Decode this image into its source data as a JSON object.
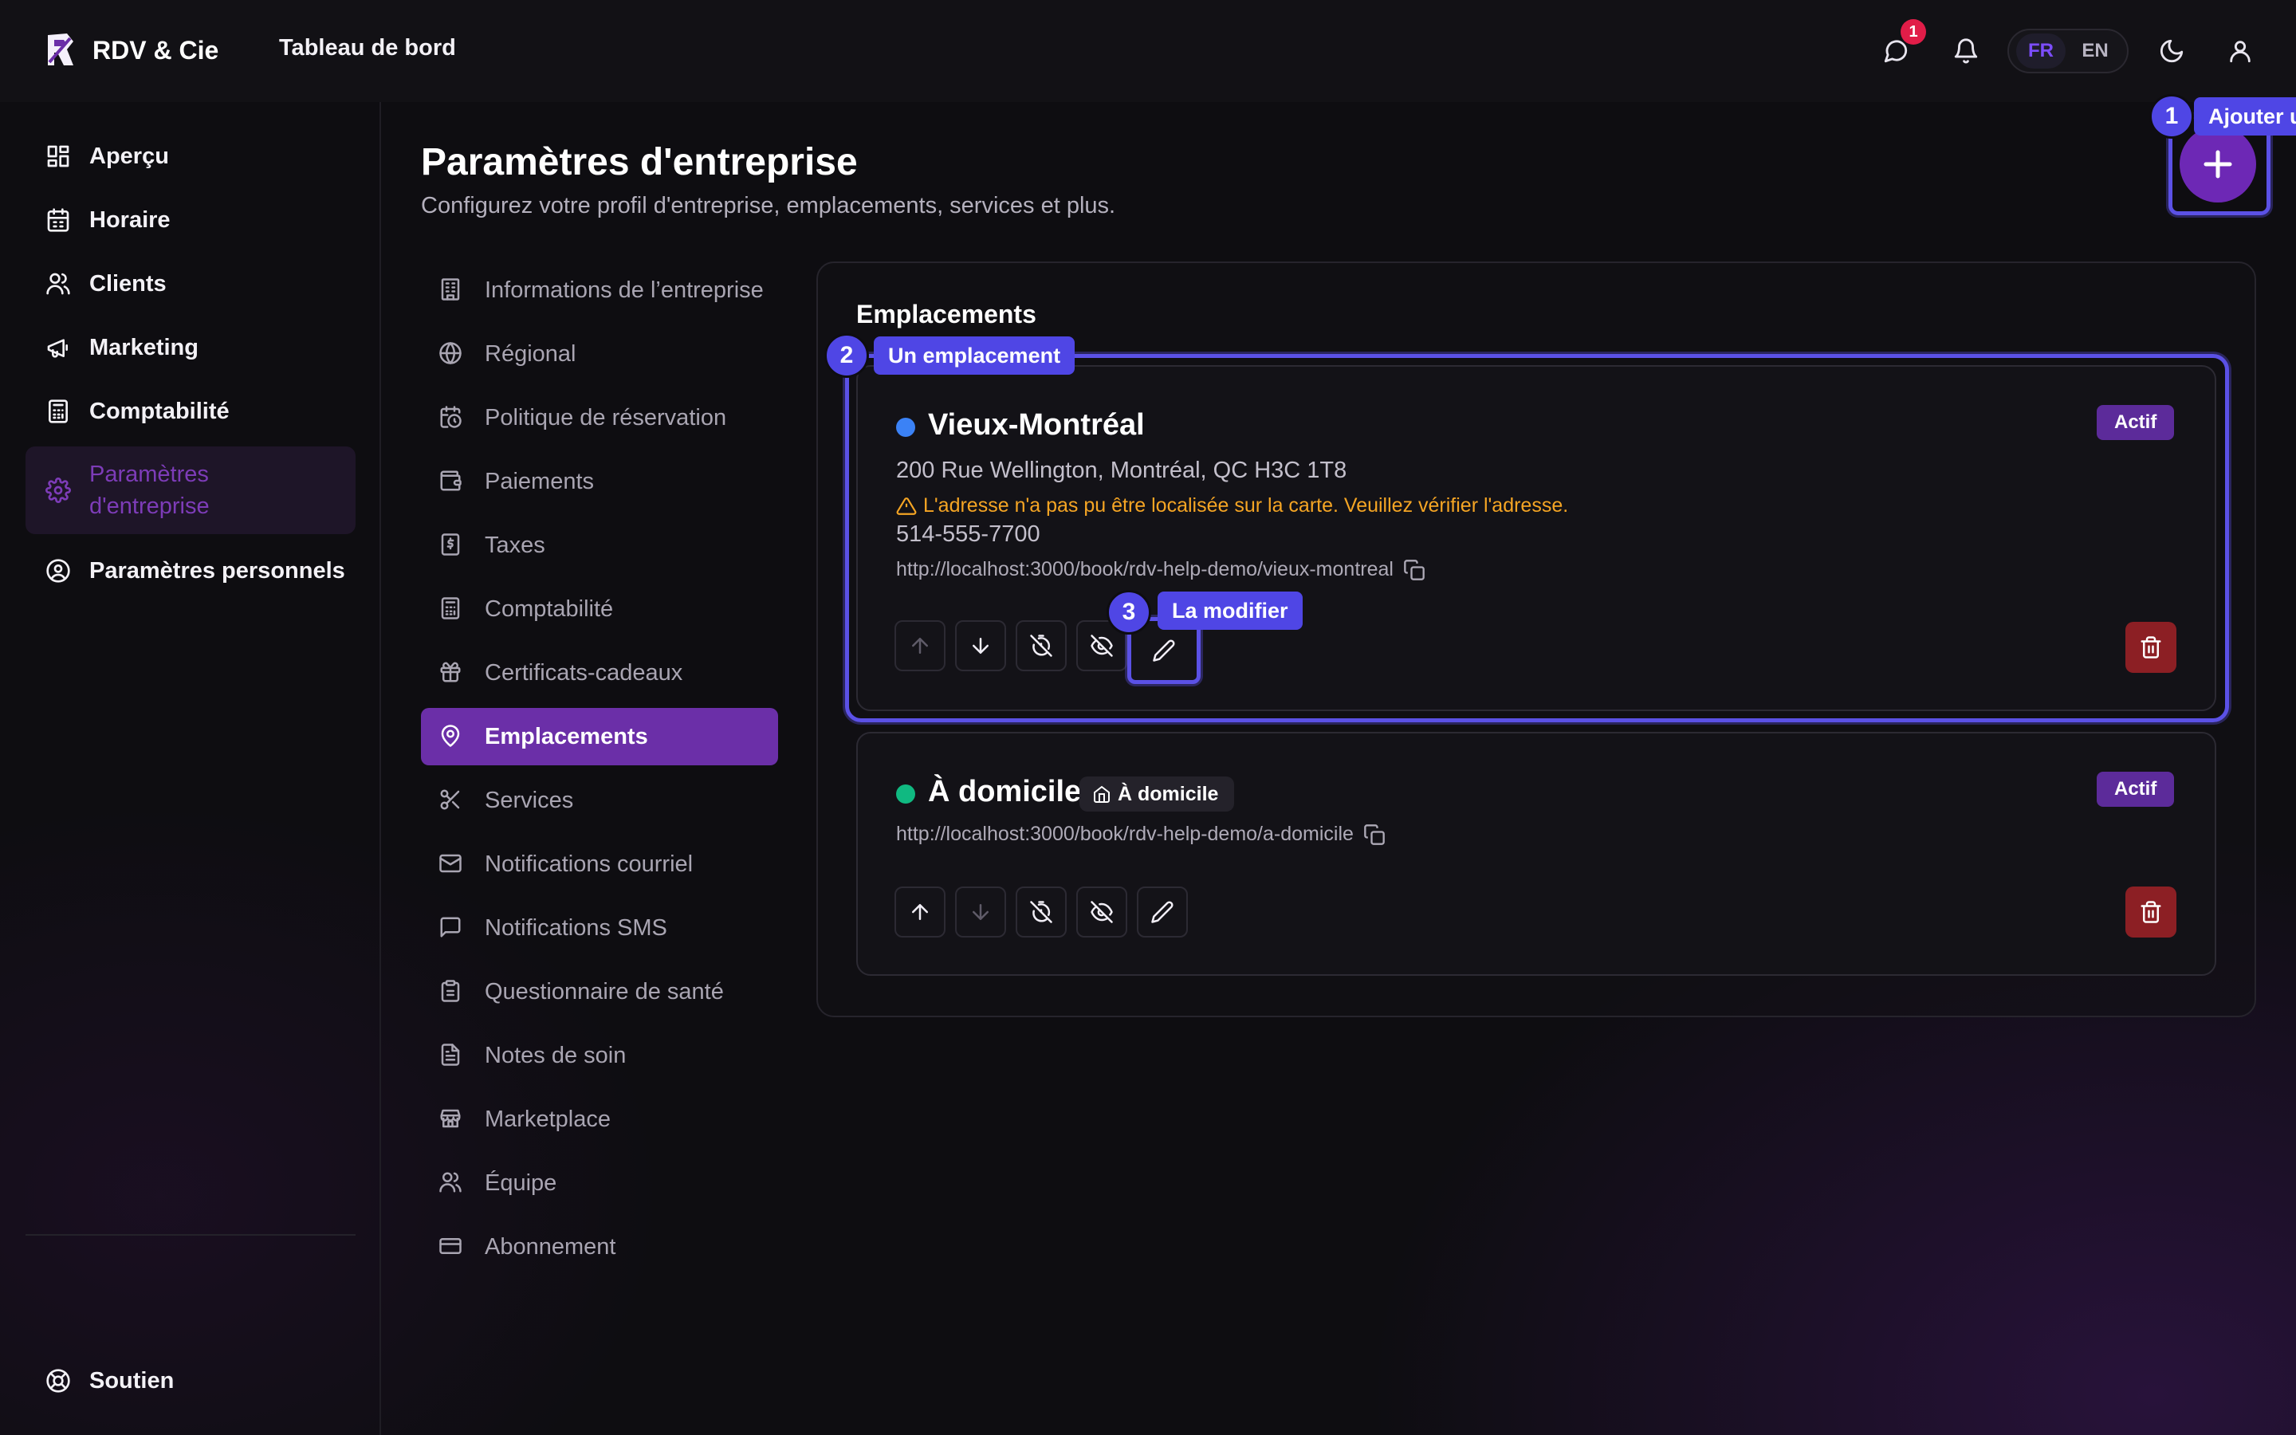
{
  "header": {
    "brand": "RDV & Cie",
    "title": "Tableau de bord",
    "notification_count": "1",
    "languages": [
      "FR",
      "EN"
    ]
  },
  "sidebar": {
    "items": [
      {
        "label": "Aperçu",
        "icon": "dashboard-icon"
      },
      {
        "label": "Horaire",
        "icon": "calendar-icon"
      },
      {
        "label": "Clients",
        "icon": "users-icon"
      },
      {
        "label": "Marketing",
        "icon": "megaphone-icon"
      },
      {
        "label": "Comptabilité",
        "icon": "calculator-icon"
      },
      {
        "label": "Paramètres\nd'entreprise",
        "icon": "gear-icon",
        "active": true
      },
      {
        "label": "Paramètres personnels",
        "icon": "user-circle-icon"
      }
    ],
    "footer": {
      "label": "Soutien",
      "icon": "lifebuoy-icon"
    }
  },
  "main": {
    "title": "Paramètres d'entreprise",
    "subtitle": "Configurez votre profil d'entreprise, emplacements, services et plus.",
    "settings_nav": [
      "Informations de l’entreprise",
      "Régional",
      "Politique de réservation",
      "Paiements",
      "Taxes",
      "Comptabilité",
      "Certificats-cadeaux",
      "Emplacements",
      "Services",
      "Notifications courriel",
      "Notifications SMS",
      "Questionnaire de santé",
      "Notes de soin",
      "Marketplace",
      "Équipe",
      "Abonnement"
    ],
    "panel_title": "Emplacements",
    "locations": [
      {
        "name": "Vieux-Montréal",
        "status": "Actif",
        "dot_color": "#3b82f6",
        "address": "200 Rue Wellington, Montréal, QC H3C 1T8",
        "warning": "L'adresse n'a pas pu être localisée sur la carte. Veuillez vérifier l'adresse.",
        "phone": "514-555-7700",
        "url": "http://localhost:3000/book/rdv-help-demo/vieux-montreal"
      },
      {
        "name": "À domicile",
        "status": "Actif",
        "dot_color": "#10b981",
        "tag": "À domicile",
        "url": "http://localhost:3000/book/rdv-help-demo/a-domicile"
      }
    ]
  },
  "tour": {
    "step1": {
      "number": "1",
      "label": "Ajouter u"
    },
    "step2": {
      "number": "2",
      "label": "Un emplacement"
    },
    "step3": {
      "number": "3",
      "label": "La modifier"
    }
  },
  "colors": {
    "accent": "#6b2fa8",
    "tour": "#4f46e5",
    "danger": "#8c1f24",
    "warning": "#f5a524"
  }
}
